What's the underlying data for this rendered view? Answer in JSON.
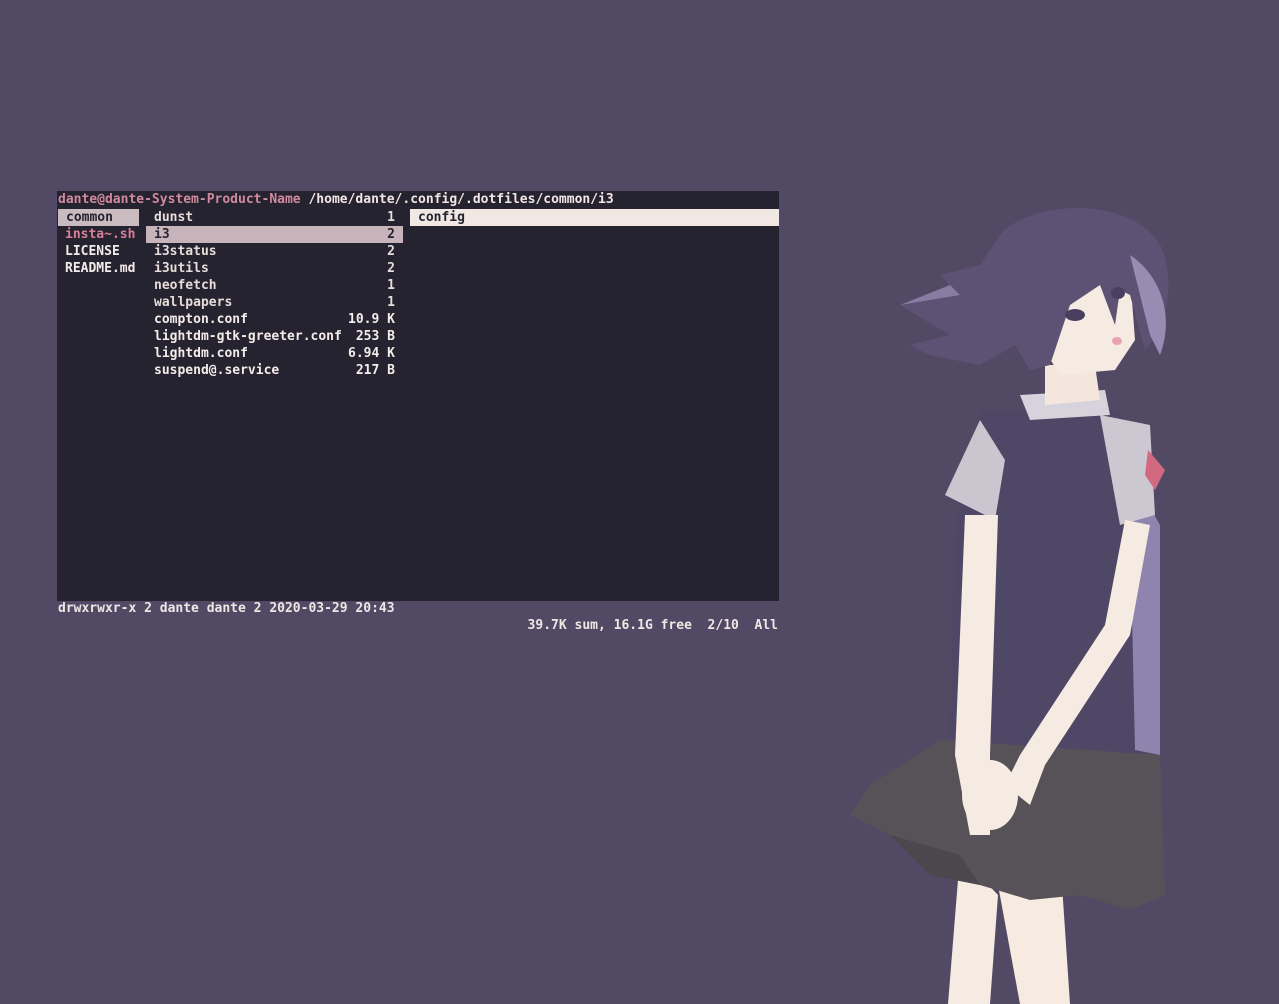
{
  "terminal": {
    "title_host": "dante@dante-System-Product-Name",
    "title_path": " /home/dante/.config/.dotfiles/common/i3"
  },
  "parent_column": [
    {
      "name": "common",
      "type": "dir",
      "selected": true
    },
    {
      "name": "insta~.sh",
      "type": "exec"
    },
    {
      "name": "LICENSE",
      "type": "file"
    },
    {
      "name": "README.md",
      "type": "file"
    }
  ],
  "current_column": [
    {
      "name": "dunst",
      "size": "1",
      "type": "dir"
    },
    {
      "name": "i3",
      "size": "2",
      "type": "dir",
      "selected": true
    },
    {
      "name": "i3status",
      "size": "2",
      "type": "dir"
    },
    {
      "name": "i3utils",
      "size": "2",
      "type": "dir"
    },
    {
      "name": "neofetch",
      "size": "1",
      "type": "dir"
    },
    {
      "name": "wallpapers",
      "size": "1",
      "type": "dir"
    },
    {
      "name": "compton.conf",
      "size": "10.9 K",
      "type": "file"
    },
    {
      "name": "lightdm-gtk-greeter.conf",
      "size": "253 B",
      "type": "file"
    },
    {
      "name": "lightdm.conf",
      "size": "6.94 K",
      "type": "file"
    },
    {
      "name": "suspend@.service",
      "size": "217 B",
      "type": "file"
    }
  ],
  "preview_column": [
    {
      "name": "config",
      "type": "file",
      "selected": true
    }
  ],
  "statusbar": {
    "left": "drwxrwxr-x 2 dante dante 2 2020-03-29 20:43",
    "right": "39.7K sum, 16.1G free  2/10  All"
  },
  "colors": {
    "background": "#524a65",
    "terminal_bg": "#262331",
    "host_color": "#d08a9e",
    "selection": "#c7b4ba"
  },
  "icons": {
    "wallpaper": "anime-girl-illustration"
  }
}
